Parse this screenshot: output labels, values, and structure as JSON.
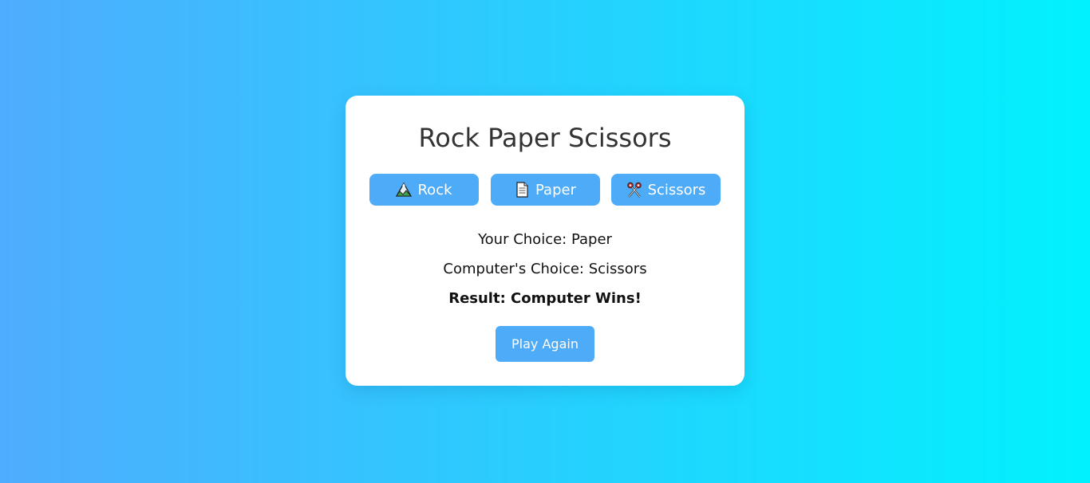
{
  "game": {
    "title": "Rock Paper Scissors",
    "choices": [
      {
        "label": "Rock",
        "icon": "rock-icon"
      },
      {
        "label": "Paper",
        "icon": "paper-icon"
      },
      {
        "label": "Scissors",
        "icon": "scissors-icon"
      }
    ],
    "your_choice": "Your Choice: Paper",
    "computer_choice": "Computer's Choice: Scissors",
    "result": "Result: Computer Wins!",
    "play_again_label": "Play Again"
  },
  "colors": {
    "background_gradient_start": "#4facfe",
    "background_gradient_end": "#00f2fe",
    "button": "#4dabf7",
    "card": "#ffffff"
  }
}
